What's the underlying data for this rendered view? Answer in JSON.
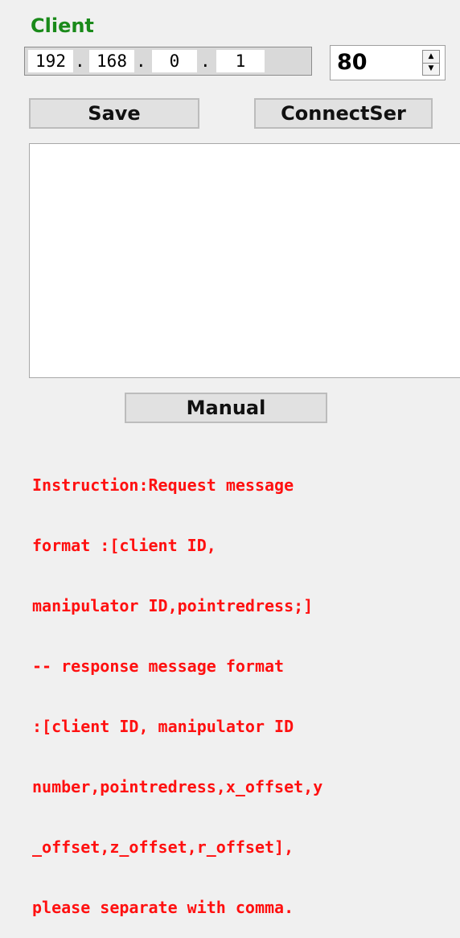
{
  "client": {
    "group_title": "Client",
    "ip": {
      "octets": [
        "192",
        "168",
        "0",
        "1"
      ],
      "separator": "."
    },
    "port": {
      "value": "80",
      "up_icon": "▲",
      "down_icon": "▼"
    },
    "save_label": "Save",
    "connect_label": "ConnectSer",
    "message_box_value": "",
    "manual_label": "Manual",
    "instruction_lines": [
      "Instruction:Request message",
      "format :[client ID,",
      "manipulator ID,pointredress;]",
      "-- response message format",
      ":[client ID, manipulator ID",
      "number,pointredress,x_offset,y",
      "_offset,z_offset,r_offset],",
      "please separate with comma."
    ]
  },
  "colors": {
    "title_green": "#1a8a1a",
    "instruction_red": "#ff1010",
    "background": "#f0f0f0"
  }
}
